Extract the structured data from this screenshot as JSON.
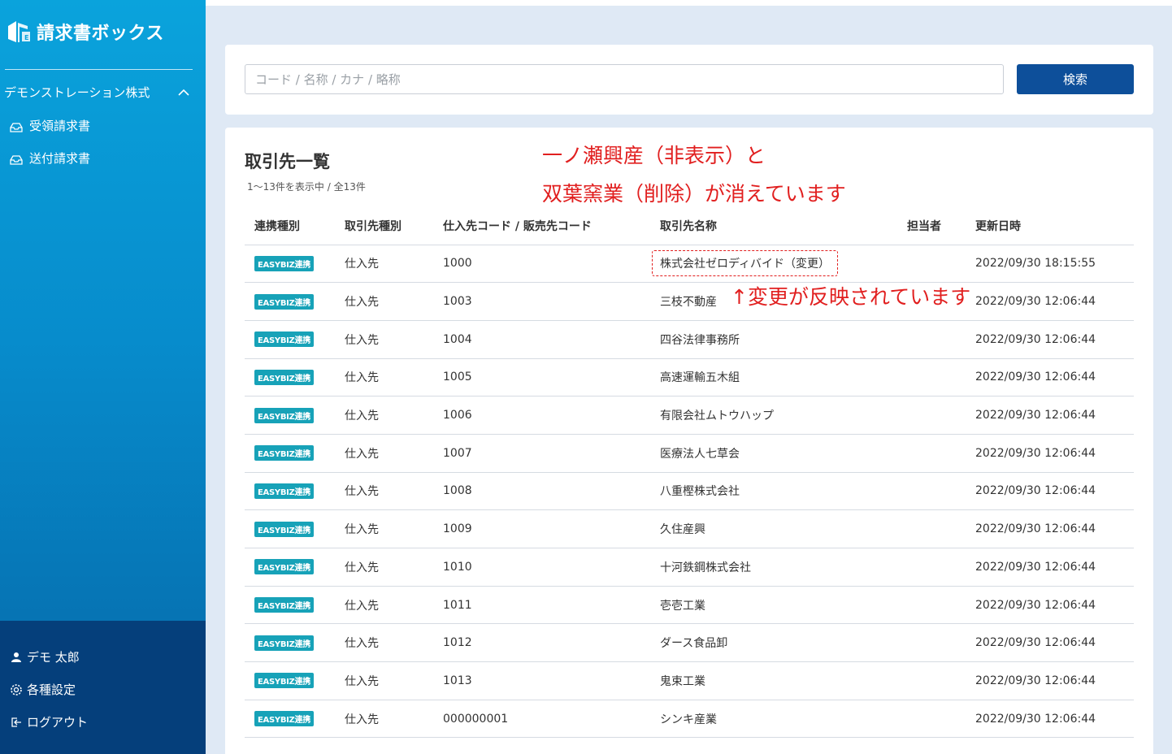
{
  "app": {
    "title": "請求書ボックス"
  },
  "sidebar": {
    "company": "デモンストレーション株式",
    "items": [
      {
        "label": "受領請求書",
        "icon": "inbox-icon"
      },
      {
        "label": "送付請求書",
        "icon": "inbox-icon"
      }
    ],
    "bottom": [
      {
        "label": "デモ 太郎",
        "icon": "user-icon"
      },
      {
        "label": "各種設定",
        "icon": "gear-icon"
      },
      {
        "label": "ログアウト",
        "icon": "logout-icon"
      }
    ]
  },
  "search": {
    "placeholder": "コード / 名称 / カナ / 略称",
    "button": "検索"
  },
  "list": {
    "title": "取引先一覧",
    "count": "1〜13件を表示中 / 全13件",
    "columns": [
      "連携種別",
      "取引先種別",
      "仕入先コード / 販売先コード",
      "取引先名称",
      "担当者",
      "更新日時"
    ],
    "rows": [
      {
        "badge": "EASYBIZ連携",
        "type": "仕入先",
        "code": "1000",
        "name": "株式会社ゼロディバイド（変更）",
        "person": "",
        "updated": "2022/09/30 18:15:55"
      },
      {
        "badge": "EASYBIZ連携",
        "type": "仕入先",
        "code": "1003",
        "name": "三枝不動産",
        "person": "",
        "updated": "2022/09/30 12:06:44"
      },
      {
        "badge": "EASYBIZ連携",
        "type": "仕入先",
        "code": "1004",
        "name": "四谷法律事務所",
        "person": "",
        "updated": "2022/09/30 12:06:44"
      },
      {
        "badge": "EASYBIZ連携",
        "type": "仕入先",
        "code": "1005",
        "name": "高速運輸五木組",
        "person": "",
        "updated": "2022/09/30 12:06:44"
      },
      {
        "badge": "EASYBIZ連携",
        "type": "仕入先",
        "code": "1006",
        "name": "有限会社ムトウハップ",
        "person": "",
        "updated": "2022/09/30 12:06:44"
      },
      {
        "badge": "EASYBIZ連携",
        "type": "仕入先",
        "code": "1007",
        "name": "医療法人七草会",
        "person": "",
        "updated": "2022/09/30 12:06:44"
      },
      {
        "badge": "EASYBIZ連携",
        "type": "仕入先",
        "code": "1008",
        "name": "八重樫株式会社",
        "person": "",
        "updated": "2022/09/30 12:06:44"
      },
      {
        "badge": "EASYBIZ連携",
        "type": "仕入先",
        "code": "1009",
        "name": "久住産興",
        "person": "",
        "updated": "2022/09/30 12:06:44"
      },
      {
        "badge": "EASYBIZ連携",
        "type": "仕入先",
        "code": "1010",
        "name": "十河鉄鋼株式会社",
        "person": "",
        "updated": "2022/09/30 12:06:44"
      },
      {
        "badge": "EASYBIZ連携",
        "type": "仕入先",
        "code": "1011",
        "name": "壱壱工業",
        "person": "",
        "updated": "2022/09/30 12:06:44"
      },
      {
        "badge": "EASYBIZ連携",
        "type": "仕入先",
        "code": "1012",
        "name": "ダース食品卸",
        "person": "",
        "updated": "2022/09/30 12:06:44"
      },
      {
        "badge": "EASYBIZ連携",
        "type": "仕入先",
        "code": "1013",
        "name": "鬼束工業",
        "person": "",
        "updated": "2022/09/30 12:06:44"
      },
      {
        "badge": "EASYBIZ連携",
        "type": "仕入先",
        "code": "000000001",
        "name": "シンキ産業",
        "person": "",
        "updated": "2022/09/30 12:06:44"
      }
    ]
  },
  "annotations": {
    "line1": "一ノ瀬興産（非表示）と",
    "line2": "双葉窯業（削除）が消えています",
    "line3": "↑変更が反映されています",
    "color": "#e11f1f"
  }
}
